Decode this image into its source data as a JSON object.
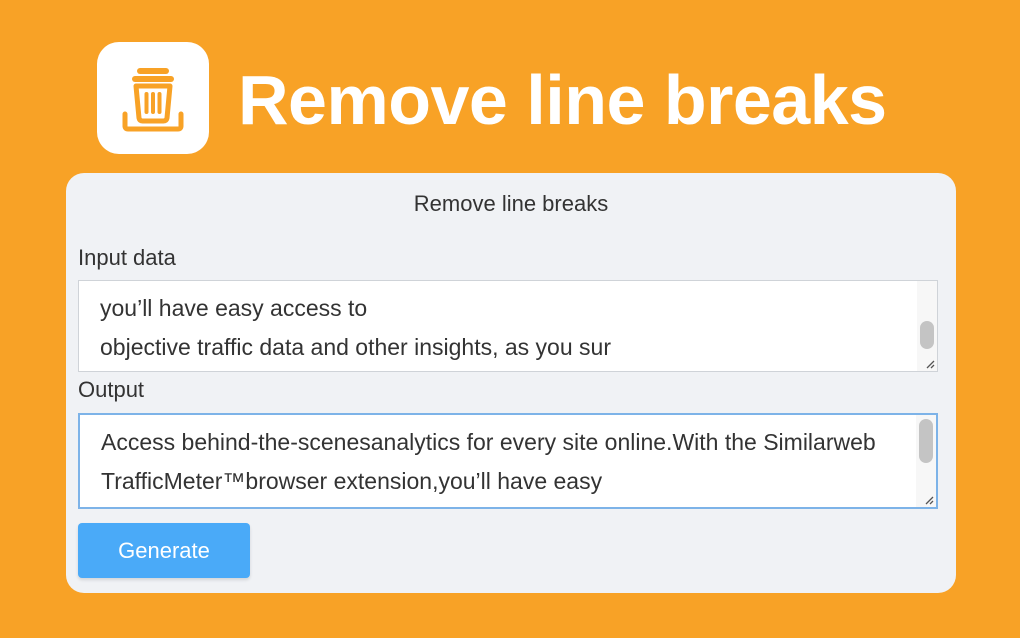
{
  "header": {
    "title": "Remove line breaks",
    "logo_icon": "trash-icon"
  },
  "panel": {
    "title": "Remove line breaks",
    "input": {
      "label": "Input data",
      "value": "you’ll have easy access to\nobjective traffic data and other insights, as you sur"
    },
    "output": {
      "label": "Output",
      "value": "Access behind-the-scenesanalytics for every site online.With the Similarweb TrafficMeter™browser extension,you’ll have easy"
    },
    "generate_label": "Generate"
  },
  "colors": {
    "background": "#f8a226",
    "panel": "#f0f2f5",
    "button": "#4aaaf8",
    "output_border": "#7db3e8"
  }
}
